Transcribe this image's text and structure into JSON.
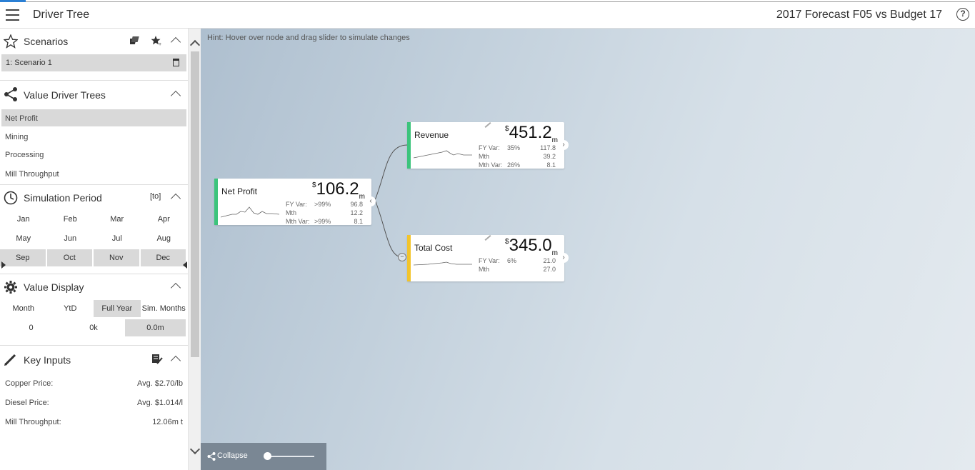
{
  "header": {
    "app_title": "Driver Tree",
    "report_title": "2017 Forecast F05 vs Budget 17",
    "help_glyph": "?"
  },
  "sidebar": {
    "scenarios": {
      "title": "Scenarios",
      "items": [
        "1: Scenario 1"
      ]
    },
    "value_driver_trees": {
      "title": "Value Driver Trees",
      "items": [
        "Net Profit",
        "Mining",
        "Processing",
        "Mill Throughput"
      ],
      "selected": "Net Profit"
    },
    "simulation_period": {
      "title": "Simulation Period",
      "tag": "[to]",
      "months": [
        "Jan",
        "Feb",
        "Mar",
        "Apr",
        "May",
        "Jun",
        "Jul",
        "Aug",
        "Sep",
        "Oct",
        "Nov",
        "Dec"
      ],
      "selected_months": [
        "Sep",
        "Oct",
        "Nov",
        "Dec"
      ]
    },
    "value_display": {
      "title": "Value Display",
      "options": [
        "Month",
        "YtD",
        "Full Year",
        "Sim. Months"
      ],
      "selected": "Full Year",
      "values": [
        "0",
        "0k",
        "0.0m"
      ]
    },
    "key_inputs": {
      "title": "Key Inputs",
      "rows": [
        {
          "label": "Copper Price:",
          "value": "Avg. $2.70/lb"
        },
        {
          "label": "Diesel Price:",
          "value": "Avg. $1.014/l"
        },
        {
          "label": "Mill Throughput:",
          "value": "12.06m t"
        }
      ]
    }
  },
  "canvas": {
    "hint": "Hint: Hover over node and drag slider to simulate changes",
    "collapse_label": "Collapse"
  },
  "nodes": {
    "net_profit": {
      "name": "Net Profit",
      "currency": "$",
      "value": "106.2",
      "unit": "m",
      "color": "#3cc47c",
      "rows": [
        {
          "label": "FY Var:",
          "pct": ">99%",
          "num": "96.8"
        },
        {
          "label": "Mth",
          "pct": "",
          "num": "12.2"
        },
        {
          "label": "Mth Var:",
          "pct": ">99%",
          "num": "8.1"
        }
      ]
    },
    "revenue": {
      "name": "Revenue",
      "currency": "$",
      "value": "451.2",
      "unit": "m",
      "color": "#3cc47c",
      "rows": [
        {
          "label": "FY Var:",
          "pct": "35%",
          "num": "117.8"
        },
        {
          "label": "Mth",
          "pct": "",
          "num": "39.2"
        },
        {
          "label": "Mth Var:",
          "pct": "26%",
          "num": "8.1"
        }
      ]
    },
    "total_cost": {
      "name": "Total Cost",
      "currency": "$",
      "value": "345.0",
      "unit": "m",
      "color": "#f2c42c",
      "rows": [
        {
          "label": "FY Var:",
          "pct": "6%",
          "num": "21.0"
        },
        {
          "label": "Mth",
          "pct": "",
          "num": "27.0"
        }
      ]
    }
  }
}
